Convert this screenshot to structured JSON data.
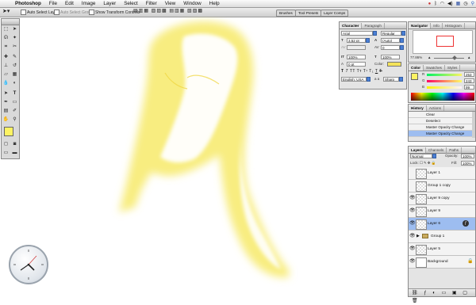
{
  "menubar": {
    "app": "Photoshop",
    "items": [
      "File",
      "Edit",
      "Image",
      "Layer",
      "Select",
      "Filter",
      "View",
      "Window",
      "Help"
    ]
  },
  "options_bar": {
    "auto_select_layer": "Auto Select Layer",
    "auto_select_groups": "Auto Select Groups",
    "show_transform_controls": "Show Transform Controls",
    "well_tabs": [
      "Brushes",
      "Tool Presets",
      "Layer Comps"
    ]
  },
  "character_panel": {
    "tabs": [
      "Character",
      "Paragraph"
    ],
    "font_family": "Arial",
    "font_style": "Regular",
    "font_size": "3.52 pt",
    "leading": "(Auto)",
    "tracking": "0",
    "vertical_scale": "100%",
    "horizontal_scale": "100%",
    "baseline_shift": "0 pt",
    "color_label": "Color:",
    "language": "English: USA",
    "antialias": "Sharp",
    "color_swatch": "#f4e35a"
  },
  "navigator_panel": {
    "tabs": [
      "Navigator",
      "Info",
      "Histogram"
    ],
    "zoom": "77.86%"
  },
  "color_panel": {
    "tabs": [
      "Color",
      "Swatches",
      "Styles"
    ],
    "r_label": "R",
    "g_label": "G",
    "b_label": "B",
    "r": "253",
    "g": "243",
    "b": "99",
    "foreground": "#fdf363"
  },
  "history_panel": {
    "tabs": [
      "History",
      "Actions"
    ],
    "items": [
      "Clear",
      "Deselect",
      "Master Opacity Change",
      "Master Opacity Change"
    ],
    "selected_index": 3
  },
  "layers_panel": {
    "tabs": [
      "Layers",
      "Channels",
      "Paths"
    ],
    "blend_mode": "Normal",
    "opacity_label": "Opacity:",
    "opacity": "100%",
    "lock_label": "Lock:",
    "fill_label": "Fill:",
    "fill": "100%",
    "layers": [
      {
        "name": "Layer 1",
        "visible": false
      },
      {
        "name": "Group 1 copy",
        "visible": false
      },
      {
        "name": "Layer 9 copy",
        "visible": true
      },
      {
        "name": "Layer 9",
        "visible": true
      },
      {
        "name": "Layer 6",
        "visible": true,
        "selected": true
      },
      {
        "name": "Group 1",
        "visible": true,
        "group": true
      },
      {
        "name": "Layer 5",
        "visible": true
      },
      {
        "name": "Background",
        "visible": true,
        "locked": true
      }
    ]
  },
  "colors": {
    "accent_blue": "#4a7fd6",
    "paint_yellow": "#f6ea5c",
    "foreground_swatch": "#fdf363",
    "background_swatch": "#ffffff"
  }
}
